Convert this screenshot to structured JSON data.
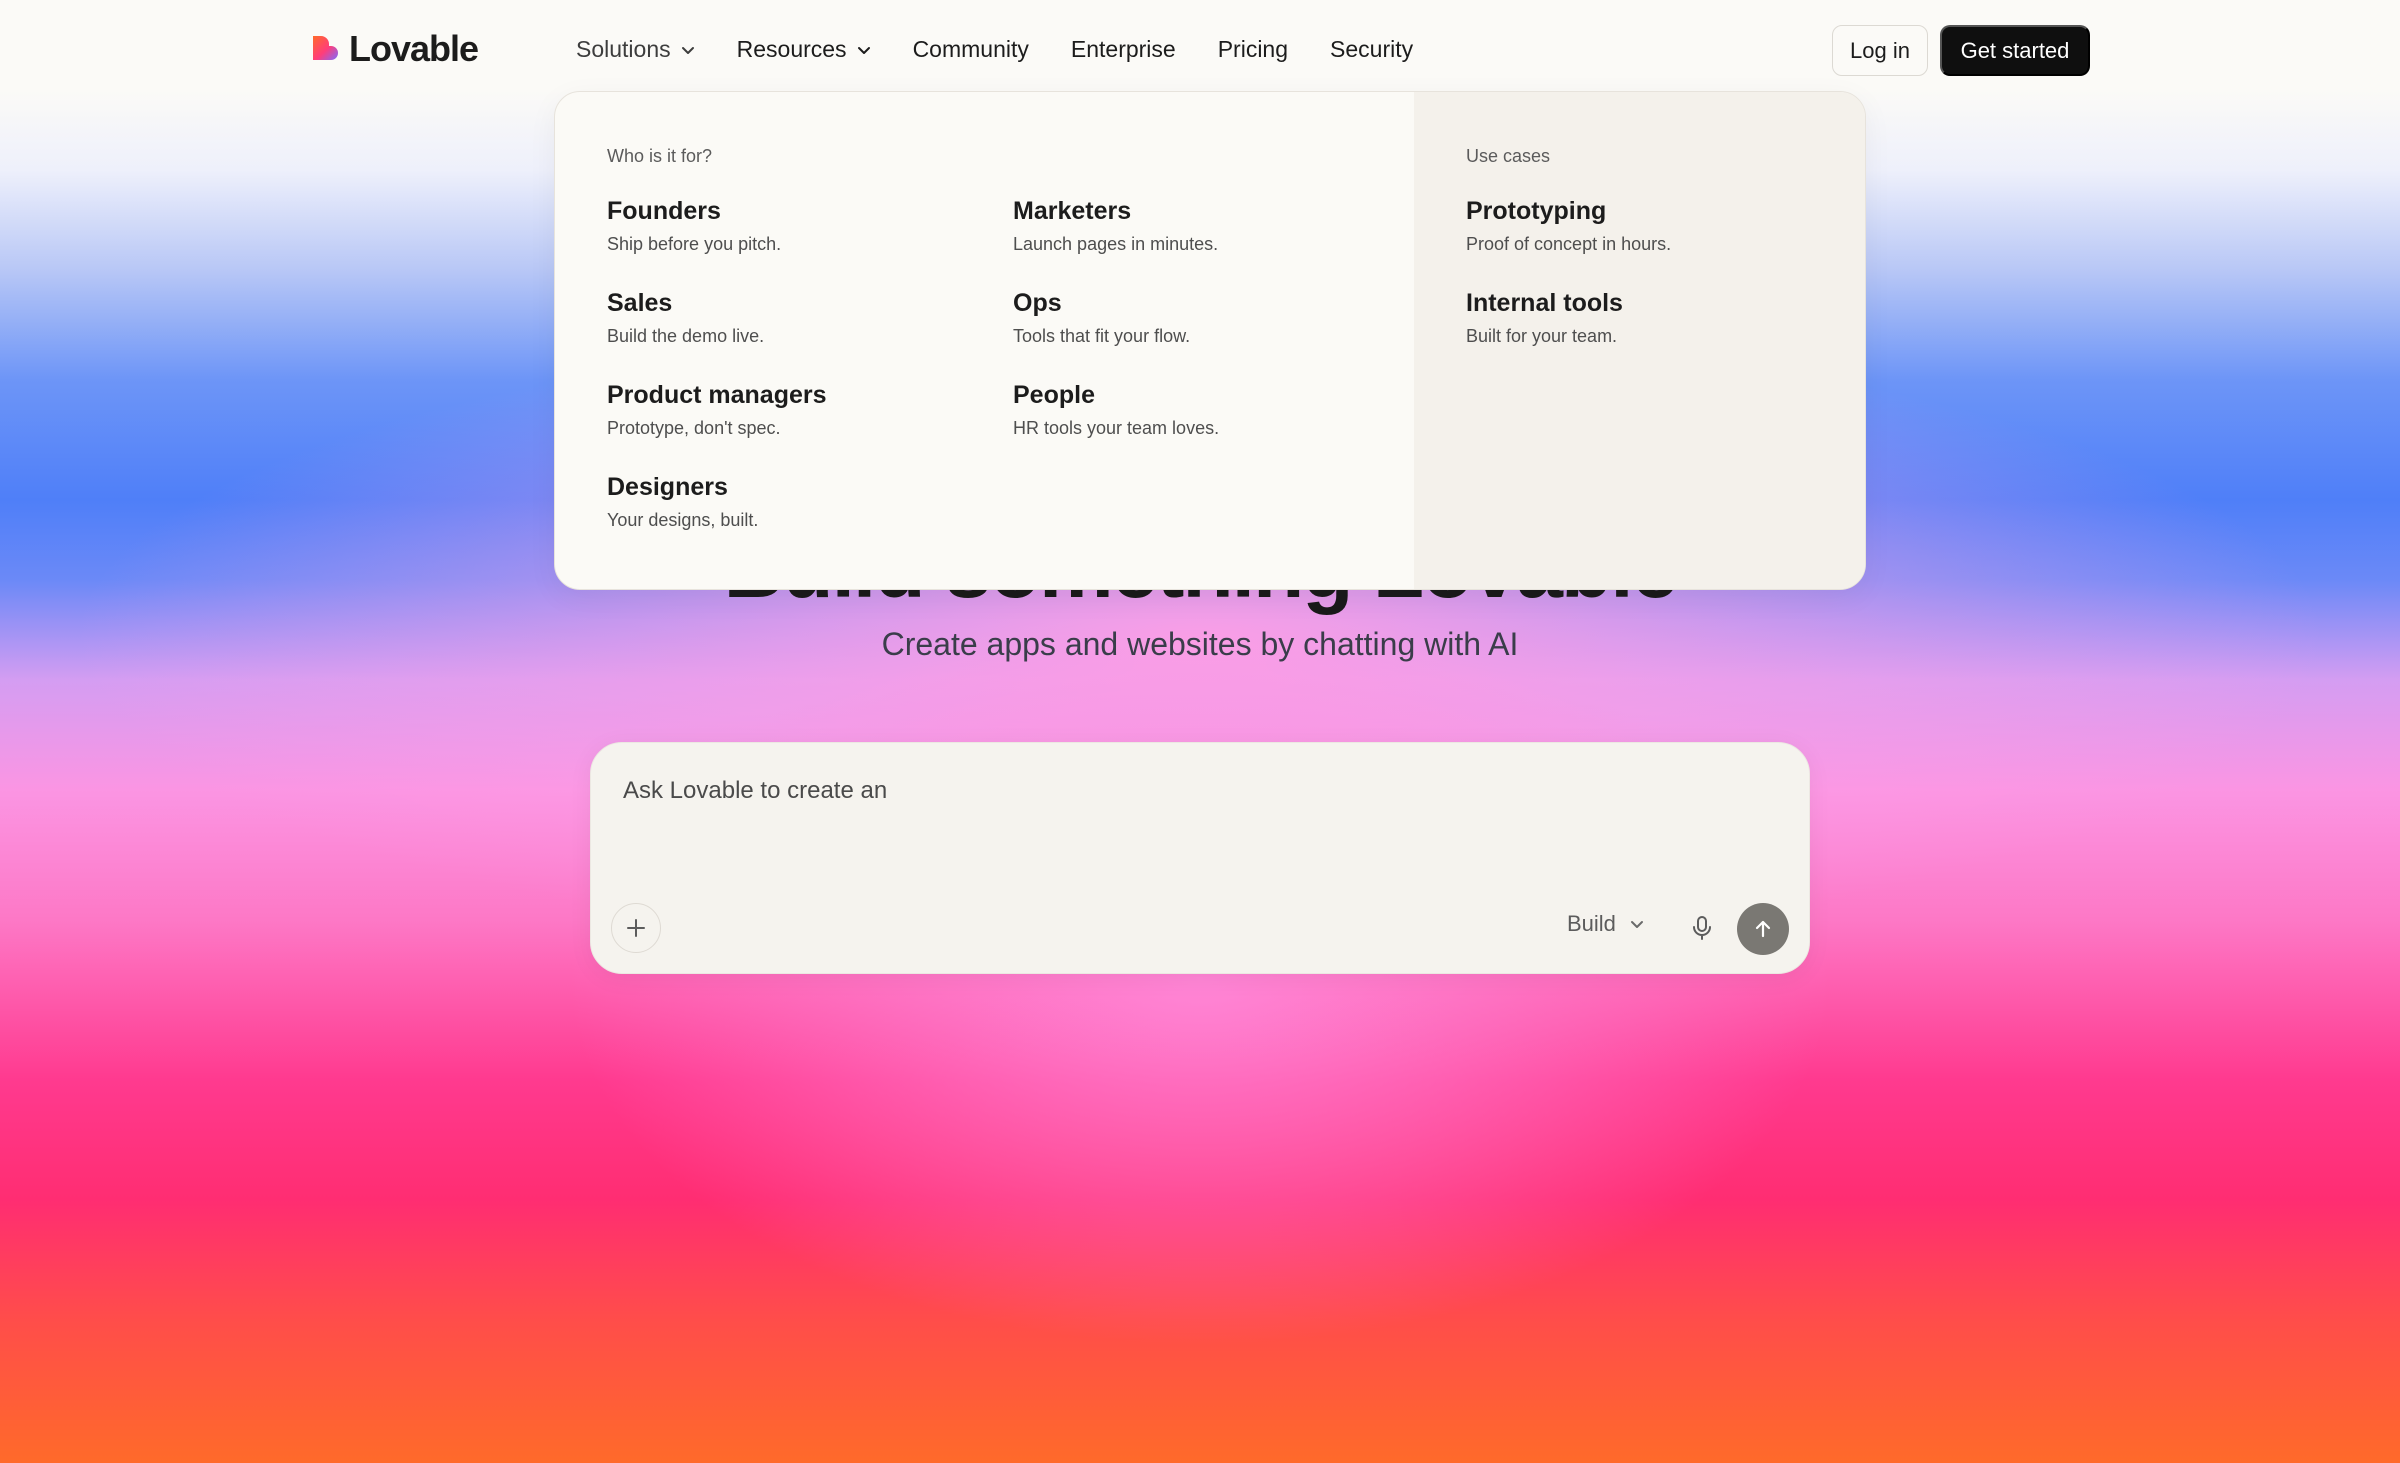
{
  "brand": {
    "name": "Lovable"
  },
  "nav": {
    "items": [
      {
        "label": "Solutions",
        "has_dropdown": true,
        "active": true
      },
      {
        "label": "Resources",
        "has_dropdown": true,
        "active": false
      },
      {
        "label": "Community",
        "has_dropdown": false,
        "active": false
      },
      {
        "label": "Enterprise",
        "has_dropdown": false,
        "active": false
      },
      {
        "label": "Pricing",
        "has_dropdown": false,
        "active": false
      },
      {
        "label": "Security",
        "has_dropdown": false,
        "active": false
      }
    ],
    "login_label": "Log in",
    "get_started_label": "Get started"
  },
  "dropdown": {
    "audience_heading": "Who is it for?",
    "audience": [
      {
        "title": "Founders",
        "desc": "Ship before you pitch."
      },
      {
        "title": "Marketers",
        "desc": "Launch pages in minutes."
      },
      {
        "title": "Sales",
        "desc": "Build the demo live."
      },
      {
        "title": "Ops",
        "desc": "Tools that fit your flow."
      },
      {
        "title": "Product managers",
        "desc": "Prototype, don't spec."
      },
      {
        "title": "People",
        "desc": "HR tools your team loves."
      },
      {
        "title": "Designers",
        "desc": "Your designs, built."
      }
    ],
    "use_cases_heading": "Use cases",
    "use_cases": [
      {
        "title": "Prototyping",
        "desc": "Proof of concept in hours."
      },
      {
        "title": "Internal tools",
        "desc": "Built for your team."
      }
    ]
  },
  "hero": {
    "title": "Build something Lovable",
    "subtitle": "Create apps and websites by chatting with AI"
  },
  "prompt": {
    "placeholder": "Ask Lovable to create an",
    "mode_label": "Build",
    "icons": {
      "attach": "plus-icon",
      "mode": "chevron-down-icon",
      "voice": "microphone-icon",
      "send": "arrow-up-icon"
    }
  },
  "colors": {
    "primary_button": "#0f0f0f",
    "send_button": "#7a7873",
    "dropdown_bg": "#fbfaf6",
    "dropdown_side_bg": "#f4f1eb"
  }
}
